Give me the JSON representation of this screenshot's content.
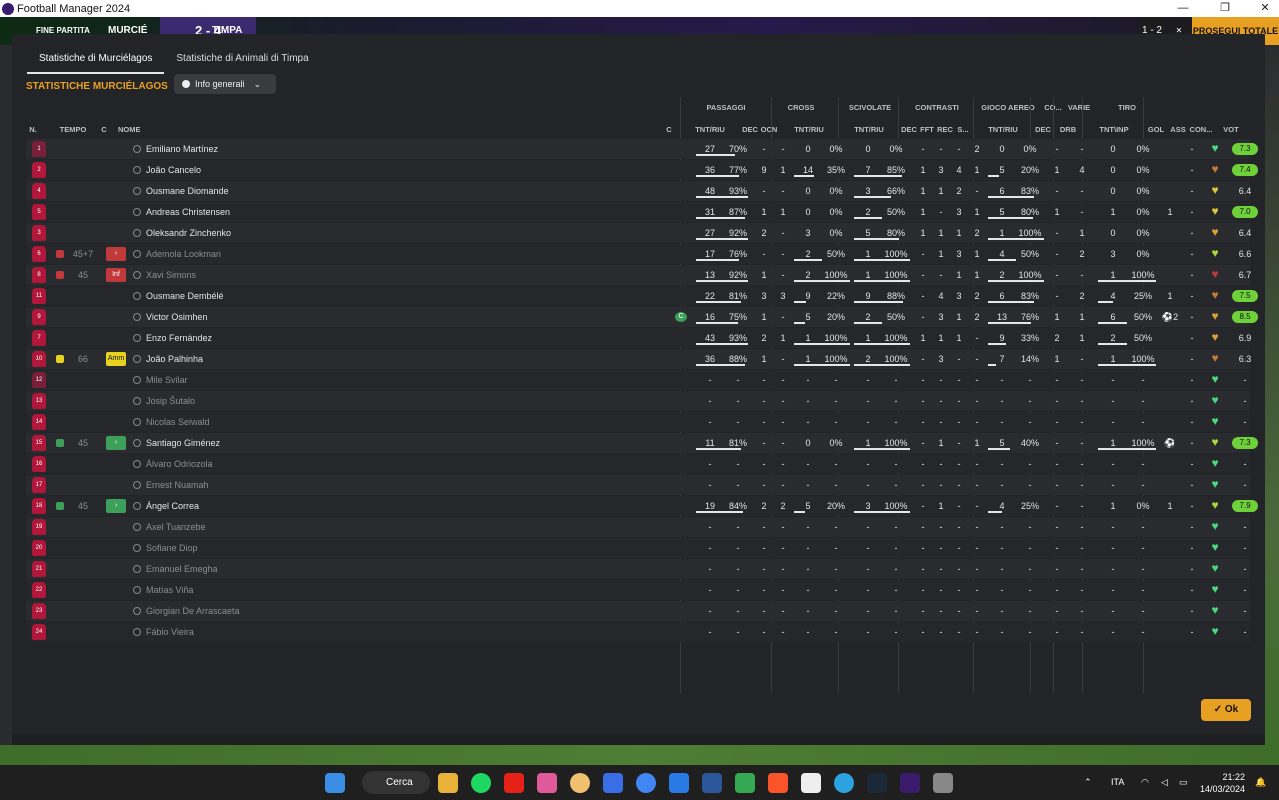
{
  "window": {
    "title": "Football Manager 2024",
    "minimize": "—",
    "maximize": "❐",
    "close": "✕"
  },
  "topbar": {
    "status": "FINE PARTITA",
    "home": "MURCIÉ",
    "score": "2 - 4",
    "away": "TIMPA",
    "right_score": "1 - 2",
    "continue": "PROSEGUI ▾ ✕",
    "proceed": "PROSEGUI TOTALE"
  },
  "tabs": [
    {
      "label": "Statistiche di Murciélagos"
    },
    {
      "label": "Statistiche di Animali di Timpa"
    }
  ],
  "section_title": "STATISTICHE MURCIÉLAGOS",
  "dropdown": {
    "label": "Info generali"
  },
  "groups": {
    "passaggi": "PASSAGGI",
    "cross": "CROSS",
    "scivolate": "SCIVOLATE",
    "contrasti": "CONTRASTI",
    "gioco_aereo": "GIOCO AEREO",
    "co": "CO...",
    "varie": "VARIE",
    "tiro": "TIRO"
  },
  "columns": {
    "n": "N.",
    "tempo": "TEMPO",
    "c": "C",
    "nome": "NOME",
    "cap": "C",
    "pass_tnt": "TNT/RIU",
    "pass_dec": "DEC",
    "pass_ocn": "OCN",
    "cross_tnt": "TNT/RIU",
    "sciv_tnt": "TNT/RIU",
    "con_dec": "DEC",
    "con_fft": "FFT",
    "con_rec": "REC",
    "con_s": "S...",
    "aer_tnt": "TNT/RIU",
    "co_dec": "DEC",
    "drb": "DRB",
    "tiro_tnt": "TNT\\INP",
    "gol": "GOL",
    "ass": "ASS",
    "con": "CON...",
    "vot": "VOT"
  },
  "players": [
    {
      "n": "1",
      "name": "Emiliano Martínez",
      "gk": true,
      "pt": "27",
      "pp": "70%",
      "pf": 0.7,
      "pd": "-",
      "po": "-",
      "ct": "0",
      "cp": "0%",
      "cf": 0,
      "st": "0",
      "sp": "0%",
      "sf": 0,
      "kd": "-",
      "kf": "-",
      "kr": "-",
      "ks": "2",
      "at": "0",
      "ap": "0%",
      "af": 0,
      "cd": "-",
      "dr": "-",
      "tt": "0",
      "tp": "0%",
      "tf": 0,
      "gol": "",
      "ass": "-",
      "heart": "#4cd97b",
      "vot": "7.3",
      "rc": "#6fd13a",
      "tempo": "",
      "ev": "",
      "badge": "",
      "cap": "",
      "dim": false
    },
    {
      "n": "2",
      "name": "João Cancelo",
      "pt": "36",
      "pp": "77%",
      "pf": 0.77,
      "pd": "9",
      "po": "1",
      "ct": "14",
      "cp": "35%",
      "cf": 0.35,
      "st": "7",
      "sp": "85%",
      "sf": 0.85,
      "kd": "1",
      "kf": "3",
      "kr": "4",
      "ks": "1",
      "at": "5",
      "ap": "20%",
      "af": 0.2,
      "cd": "1",
      "dr": "4",
      "tt": "0",
      "tp": "0%",
      "tf": 0,
      "gol": "",
      "ass": "-",
      "heart": "#c07a3a",
      "vot": "7.4",
      "rc": "#6fd13a",
      "tempo": "",
      "ev": "",
      "badge": "",
      "cap": "",
      "dim": false
    },
    {
      "n": "4",
      "name": "Ousmane Diomande",
      "pt": "48",
      "pp": "93%",
      "pf": 0.93,
      "pd": "-",
      "po": "-",
      "ct": "0",
      "cp": "0%",
      "cf": 0,
      "st": "3",
      "sp": "66%",
      "sf": 0.66,
      "kd": "1",
      "kf": "1",
      "kr": "2",
      "ks": "-",
      "at": "6",
      "ap": "83%",
      "af": 0.83,
      "cd": "-",
      "dr": "-",
      "tt": "0",
      "tp": "0%",
      "tf": 0,
      "gol": "",
      "ass": "-",
      "heart": "#d9c83a",
      "vot": "6.4",
      "rc": "",
      "tempo": "",
      "ev": "",
      "badge": "",
      "cap": "",
      "dim": false
    },
    {
      "n": "5",
      "name": "Andreas Christensen",
      "pt": "31",
      "pp": "87%",
      "pf": 0.87,
      "pd": "1",
      "po": "1",
      "ct": "0",
      "cp": "0%",
      "cf": 0,
      "st": "2",
      "sp": "50%",
      "sf": 0.5,
      "kd": "1",
      "kf": "-",
      "kr": "3",
      "ks": "1",
      "at": "5",
      "ap": "80%",
      "af": 0.8,
      "cd": "1",
      "dr": "-",
      "tt": "1",
      "tp": "0%",
      "tf": 0,
      "gol": "1",
      "ass": "-",
      "heart": "#d9c83a",
      "vot": "7.0",
      "rc": "#6fd13a",
      "tempo": "",
      "ev": "",
      "badge": "",
      "cap": "",
      "dim": false
    },
    {
      "n": "3",
      "name": "Oleksandr Zinchenko",
      "pt": "27",
      "pp": "92%",
      "pf": 0.92,
      "pd": "2",
      "po": "-",
      "ct": "3",
      "cp": "0%",
      "cf": 0,
      "st": "5",
      "sp": "80%",
      "sf": 0.8,
      "kd": "1",
      "kf": "1",
      "kr": "1",
      "ks": "2",
      "at": "1",
      "ap": "100%",
      "af": 1,
      "cd": "-",
      "dr": "1",
      "tt": "0",
      "tp": "0%",
      "tf": 0,
      "gol": "",
      "ass": "-",
      "heart": "#d9a03a",
      "vot": "6.4",
      "rc": "",
      "tempo": "",
      "ev": "",
      "badge": "",
      "cap": "",
      "dim": false
    },
    {
      "n": "6",
      "name": "Ademola Lookman",
      "pt": "17",
      "pp": "76%",
      "pf": 0.76,
      "pd": "-",
      "po": "-",
      "ct": "2",
      "cp": "50%",
      "cf": 0.5,
      "st": "1",
      "sp": "100%",
      "sf": 1,
      "kd": "-",
      "kf": "1",
      "kr": "3",
      "ks": "1",
      "at": "4",
      "ap": "50%",
      "af": 0.5,
      "cd": "-",
      "dr": "2",
      "tt": "3",
      "tp": "0%",
      "tf": 0,
      "gol": "",
      "ass": "-",
      "heart": "#a8d93a",
      "vot": "6.6",
      "rc": "",
      "tempo": "45+7",
      "ev": "sub-out",
      "badge": "‹",
      "bc": "#c0393b",
      "cap": "",
      "dim": true
    },
    {
      "n": "8",
      "name": "Xavi Simons",
      "pt": "13",
      "pp": "92%",
      "pf": 0.92,
      "pd": "1",
      "po": "-",
      "ct": "2",
      "cp": "100%",
      "cf": 1,
      "st": "1",
      "sp": "100%",
      "sf": 1,
      "kd": "-",
      "kf": "-",
      "kr": "1",
      "ks": "1",
      "at": "2",
      "ap": "100%",
      "af": 1,
      "cd": "-",
      "dr": "-",
      "tt": "1",
      "tp": "100%",
      "tf": 1,
      "gol": "",
      "ass": "-",
      "heart": "#c0393b",
      "vot": "6.7",
      "rc": "",
      "tempo": "45",
      "ev": "injury",
      "badge": "Inf",
      "bc": "#c0393b",
      "cap": "",
      "dim": true
    },
    {
      "n": "11",
      "name": "Ousmane Dembélé",
      "pt": "22",
      "pp": "81%",
      "pf": 0.81,
      "pd": "3",
      "po": "3",
      "ct": "9",
      "cp": "22%",
      "cf": 0.22,
      "st": "9",
      "sp": "88%",
      "sf": 0.88,
      "kd": "-",
      "kf": "4",
      "kr": "3",
      "ks": "2",
      "at": "6",
      "ap": "83%",
      "af": 0.83,
      "cd": "-",
      "dr": "2",
      "tt": "4",
      "tp": "25%",
      "tf": 0.25,
      "gol": "1",
      "ass": "-",
      "heart": "#c07a3a",
      "vot": "7.5",
      "rc": "#6fd13a",
      "tempo": "",
      "ev": "",
      "badge": "",
      "cap": "",
      "dim": false
    },
    {
      "n": "9",
      "name": "Victor Osimhen",
      "pt": "16",
      "pp": "75%",
      "pf": 0.75,
      "pd": "1",
      "po": "-",
      "ct": "5",
      "cp": "20%",
      "cf": 0.2,
      "st": "2",
      "sp": "50%",
      "sf": 0.5,
      "kd": "-",
      "kf": "3",
      "kr": "1",
      "ks": "2",
      "at": "13",
      "ap": "76%",
      "af": 0.76,
      "cd": "1",
      "dr": "1",
      "tt": "6",
      "tp": "50%",
      "tf": 0.5,
      "gol": "⚽2",
      "ass": "-",
      "heart": "#d9a03a",
      "vot": "8.5",
      "rc": "#6fd13a",
      "tempo": "",
      "ev": "",
      "badge": "",
      "cap": "C",
      "dim": false
    },
    {
      "n": "7",
      "name": "Enzo Fernández",
      "pt": "43",
      "pp": "93%",
      "pf": 0.93,
      "pd": "2",
      "po": "1",
      "ct": "1",
      "cp": "100%",
      "cf": 1,
      "st": "1",
      "sp": "100%",
      "sf": 1,
      "kd": "1",
      "kf": "1",
      "kr": "1",
      "ks": "-",
      "at": "9",
      "ap": "33%",
      "af": 0.33,
      "cd": "2",
      "dr": "1",
      "tt": "2",
      "tp": "50%",
      "tf": 0.5,
      "gol": "",
      "ass": "-",
      "heart": "#d9a03a",
      "vot": "6.9",
      "rc": "",
      "tempo": "",
      "ev": "",
      "badge": "",
      "cap": "",
      "dim": false
    },
    {
      "n": "10",
      "name": "João Palhinha",
      "pt": "36",
      "pp": "88%",
      "pf": 0.88,
      "pd": "1",
      "po": "-",
      "ct": "1",
      "cp": "100%",
      "cf": 1,
      "st": "2",
      "sp": "100%",
      "sf": 1,
      "kd": "-",
      "kf": "3",
      "kr": "-",
      "ks": "-",
      "at": "7",
      "ap": "14%",
      "af": 0.14,
      "cd": "1",
      "dr": "-",
      "tt": "1",
      "tp": "100%",
      "tf": 1,
      "gol": "",
      "ass": "-",
      "heart": "#c07a3a",
      "vot": "6.3",
      "rc": "",
      "tempo": "66",
      "ev": "yellow",
      "badge": "Amm",
      "bc": "#e6d21f",
      "cap": "",
      "dim": false
    },
    {
      "n": "12",
      "name": "Mile Svilar",
      "gk": true,
      "empty": true,
      "heart": "#4cd97b",
      "dim": true
    },
    {
      "n": "13",
      "name": "Josip Šutalo",
      "empty": true,
      "heart": "#4cd97b",
      "dim": true
    },
    {
      "n": "14",
      "name": "Nicolas Seiwald",
      "empty": true,
      "heart": "#4cd97b",
      "dim": true
    },
    {
      "n": "15",
      "name": "Santiago Giménez",
      "pt": "11",
      "pp": "81%",
      "pf": 0.81,
      "pd": "-",
      "po": "-",
      "ct": "0",
      "cp": "0%",
      "cf": 0,
      "st": "1",
      "sp": "100%",
      "sf": 1,
      "kd": "-",
      "kf": "1",
      "kr": "-",
      "ks": "1",
      "at": "5",
      "ap": "40%",
      "af": 0.4,
      "cd": "-",
      "dr": "-",
      "tt": "1",
      "tp": "100%",
      "tf": 1,
      "gol": "⚽",
      "ass": "-",
      "heart": "#a8d93a",
      "vot": "7.3",
      "rc": "#6fd13a",
      "tempo": "45",
      "ev": "sub-in",
      "badge": "›",
      "bc": "#3ca05a",
      "cap": "",
      "dim": false
    },
    {
      "n": "16",
      "name": "Álvaro Odriozola",
      "empty": true,
      "heart": "#4cd97b",
      "dim": true
    },
    {
      "n": "17",
      "name": "Ernest Nuamah",
      "empty": true,
      "heart": "#4cd97b",
      "dim": true
    },
    {
      "n": "18",
      "name": "Ángel Correa",
      "pt": "19",
      "pp": "84%",
      "pf": 0.84,
      "pd": "2",
      "po": "2",
      "ct": "5",
      "cp": "20%",
      "cf": 0.2,
      "st": "3",
      "sp": "100%",
      "sf": 1,
      "kd": "-",
      "kf": "1",
      "kr": "-",
      "ks": "-",
      "at": "4",
      "ap": "25%",
      "af": 0.25,
      "cd": "-",
      "dr": "-",
      "tt": "1",
      "tp": "0%",
      "tf": 0,
      "gol": "1",
      "ass": "-",
      "heart": "#a8d93a",
      "vot": "7.9",
      "rc": "#6fd13a",
      "tempo": "45",
      "ev": "sub-in",
      "badge": "›",
      "bc": "#3ca05a",
      "cap": "",
      "dim": false
    },
    {
      "n": "19",
      "name": "Axel Tuanzebe",
      "empty": true,
      "heart": "#4cd97b",
      "dim": true
    },
    {
      "n": "20",
      "name": "Sofiane Diop",
      "empty": true,
      "heart": "#4cd97b",
      "dim": true
    },
    {
      "n": "21",
      "name": "Emanuel Emegha",
      "empty": true,
      "heart": "#4cd97b",
      "dim": true
    },
    {
      "n": "22",
      "name": "Matías Viña",
      "empty": true,
      "heart": "#4cd97b",
      "dim": true
    },
    {
      "n": "23",
      "name": "Giorgian De Arrascaeta",
      "empty": true,
      "heart": "#4cd97b",
      "dim": true
    },
    {
      "n": "24",
      "name": "Fábio Vieira",
      "empty": true,
      "heart": "#4cd97b",
      "dim": true
    }
  ],
  "ok_button": "✓ Ok",
  "taskbar": {
    "search": "Cerca",
    "lang": "ITA",
    "time": "21:22",
    "date": "14/03/2024"
  }
}
